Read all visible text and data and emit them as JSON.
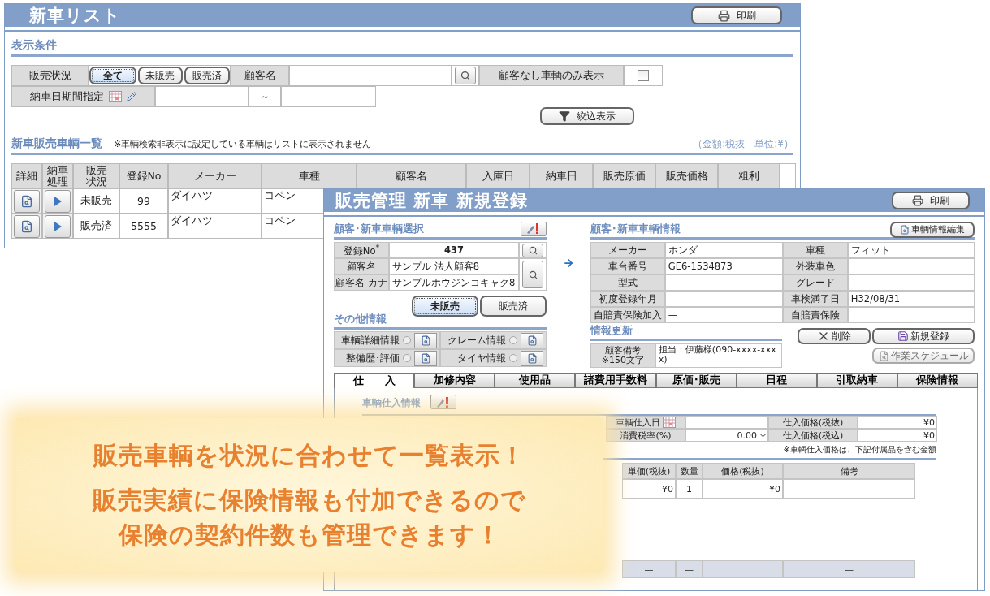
{
  "list_window": {
    "title": "新車リスト",
    "print_button": "印刷",
    "filter_heading": "表示条件",
    "filters": {
      "status_label": "販売状況",
      "status_options": [
        {
          "label": "全て",
          "selected": true
        },
        {
          "label": "未販売",
          "selected": false
        },
        {
          "label": "販売済",
          "selected": false
        }
      ],
      "customer_label": "顧客名",
      "no_customer_label": "顧客なし車輌のみ表示",
      "no_customer_checked": false,
      "delivery_period_label": "納車日期間指定",
      "range_separator": "～",
      "apply_button": "絞込表示"
    },
    "list_heading": "新車販売車輌一覧",
    "list_note": "※車輌検索非表示に設定している車輌はリストに表示されません",
    "amount_note": "（金額:税抜　単位:¥）",
    "table": {
      "columns": [
        "詳細",
        "納車処理",
        "販売状況",
        "登録No",
        "メーカー",
        "車種",
        "顧客名",
        "入庫日",
        "納車日",
        "販売原価",
        "販売価格",
        "粗利"
      ],
      "rows": [
        {
          "status": "未販売",
          "number": "99",
          "maker": "ダイハツ",
          "model": "コペン"
        },
        {
          "status": "販売済",
          "number": "5555",
          "maker": "ダイハツ",
          "model": "コペン"
        }
      ]
    }
  },
  "registration_window": {
    "title": "販売管理 新車 新規登録",
    "print_button": "印刷",
    "selection": {
      "heading": "顧客･新車車輌選択",
      "fields": [
        {
          "label": "登録No$^{*}$",
          "value": "437"
        },
        {
          "label": "顧客名",
          "value": "サンプル 法人顧客8"
        },
        {
          "label": "顧客名 カナ",
          "value": "サンプルホウジンコキャク8"
        }
      ],
      "status_options": [
        {
          "label": "未販売",
          "selected": true
        },
        {
          "label": "販売済",
          "selected": false
        }
      ]
    },
    "other_info": {
      "heading": "その他情報",
      "items": [
        {
          "label": "車輌詳細情報",
          "selected": false
        },
        {
          "label": "クレーム情報",
          "selected": false
        },
        {
          "label": "整備歴･評価",
          "selected": false
        },
        {
          "label": "タイヤ情報",
          "selected": false
        }
      ]
    },
    "vehicle_info": {
      "heading": "顧客･新車車輌情報",
      "edit_button": "車輌情報編集",
      "fields": [
        {
          "label": "メーカー",
          "value": "ホンダ"
        },
        {
          "label": "車種",
          "value": "フィット"
        },
        {
          "label": "車台番号",
          "value": "GE6-1534873"
        },
        {
          "label": "外装車色"
        },
        {
          "label": "型式"
        },
        {
          "label": "グレード"
        },
        {
          "label": "初度登録年月"
        },
        {
          "label": "車検満了日",
          "value": "H32/08/31"
        },
        {
          "label": "自賠責保険加入",
          "value": "—"
        },
        {
          "label": "自賠責保険"
        }
      ]
    },
    "update": {
      "heading": "情報更新",
      "remark_label": "顧客備考\n※150文字",
      "remark_value": "担当：伊藤様(090-xxxx-xxxx)"
    },
    "actions": [
      {
        "label": "削除",
        "kind": "delete",
        "disabled": false
      },
      {
        "label": "新規登録",
        "kind": "save",
        "disabled": false
      },
      {
        "label": "作業スケジュール",
        "kind": "schedule",
        "disabled": true
      }
    ],
    "tabs": [
      {
        "label": "仕　　入",
        "selected": true
      },
      {
        "label": "加修内容",
        "selected": false
      },
      {
        "label": "使用品",
        "selected": false
      },
      {
        "label": "諸費用手数料",
        "selected": false
      },
      {
        "label": "原価･販売",
        "selected": false
      },
      {
        "label": "日程",
        "selected": false
      },
      {
        "label": "引取納車",
        "selected": false
      },
      {
        "label": "保険情報",
        "selected": false
      }
    ],
    "purchase": {
      "heading": "車輌仕入情報",
      "date_label": "車輌仕入日",
      "tax_rate_label": "消費税率(%)",
      "tax_rate": "0.00",
      "price_ex_label": "仕入価格(税抜)",
      "price_ex": "¥0",
      "price_in_label": "仕入価格(税込)",
      "price_in": "¥0",
      "note": "※車輌仕入価格は、下記付属品を含む金額",
      "table": {
        "columns": [
          "単価(税抜)",
          "数量",
          "価格(税抜)",
          "備考"
        ],
        "row": {
          "unit_price": "¥0",
          "quantity": "1",
          "price": "¥0"
        },
        "totals": {
          "unit_price": "—",
          "quantity": "—",
          "remarks": "—"
        }
      }
    }
  },
  "callout": {
    "headline": "販売車輌を状況に合わせて一覧表示！",
    "lines": [
      "販売実績に保険情報も付加できるので",
      "保険の契約件数も管理できます！"
    ]
  }
}
